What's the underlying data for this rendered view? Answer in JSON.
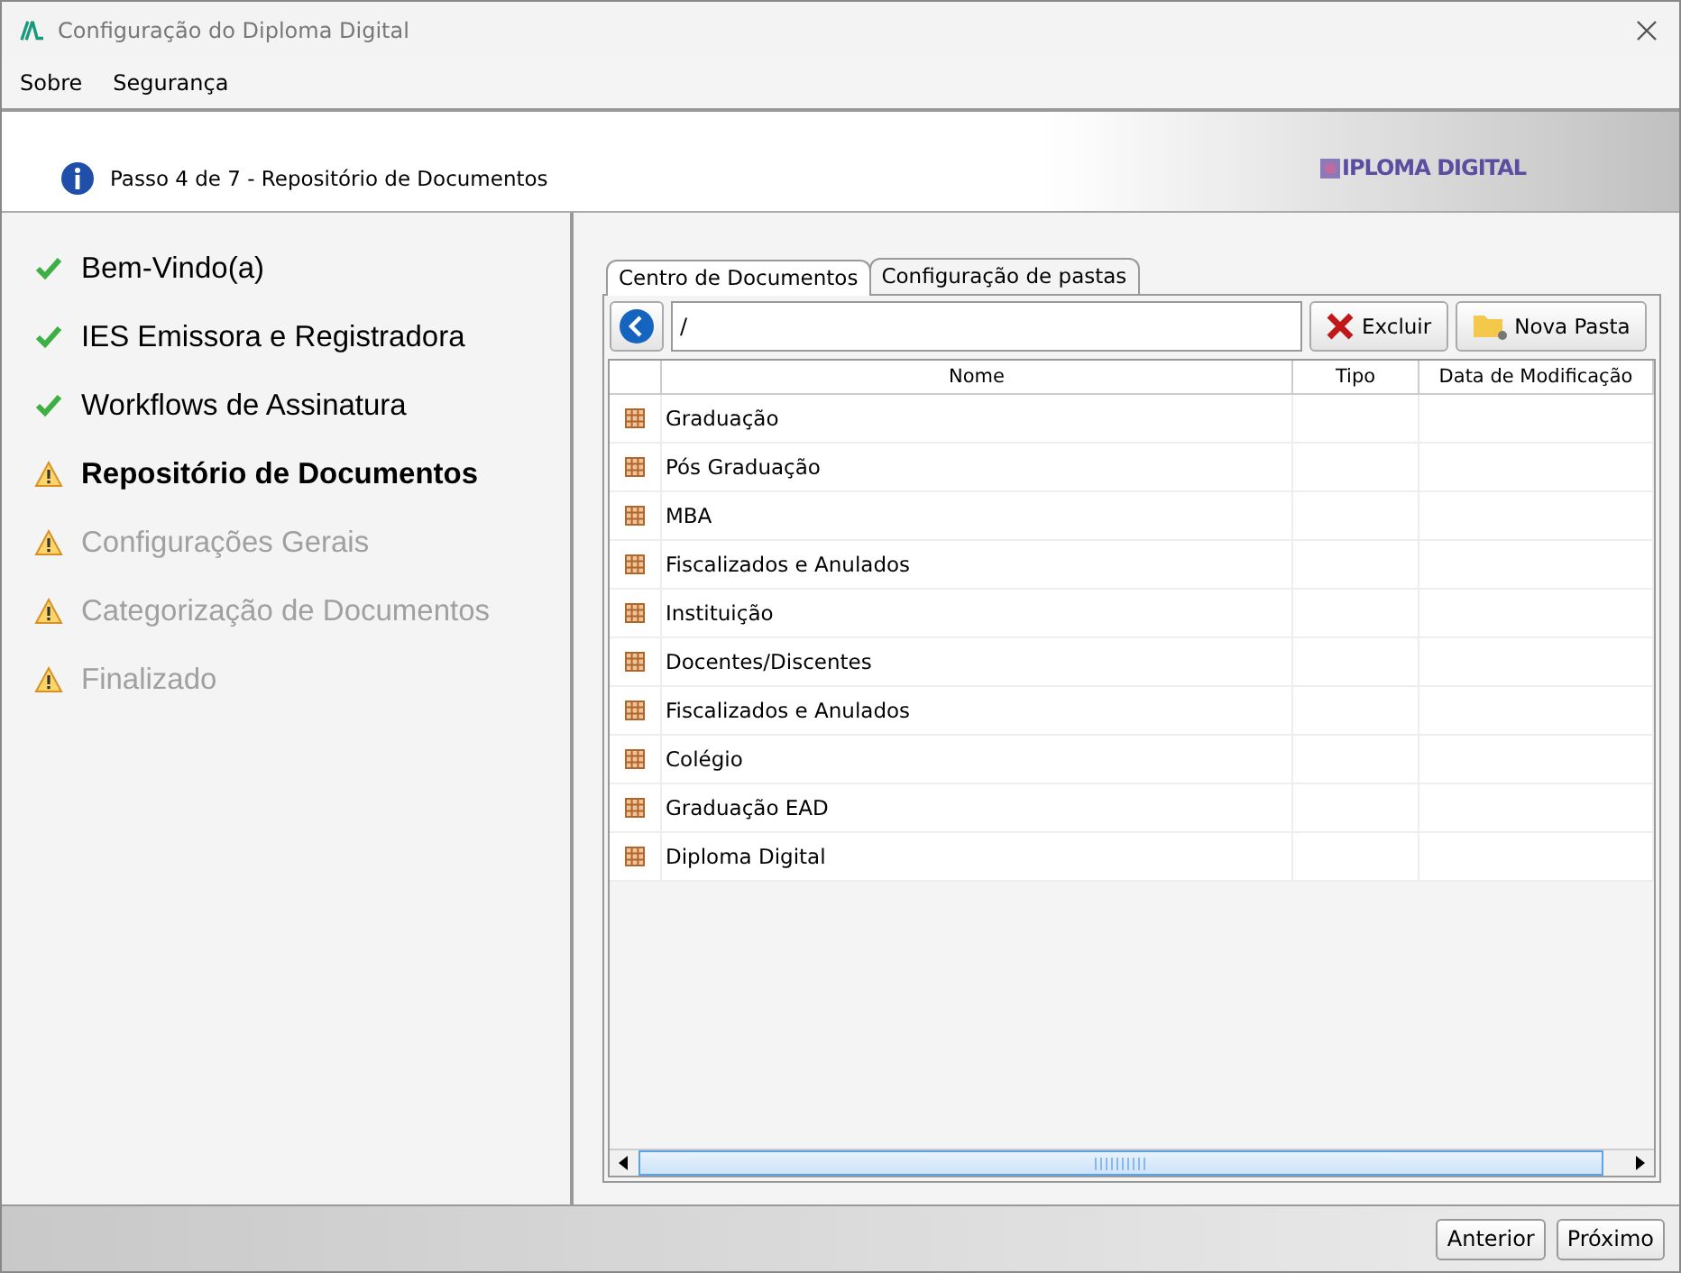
{
  "window": {
    "title": "Configuração do Diploma Digital"
  },
  "menu": [
    "Sobre",
    "Segurança"
  ],
  "header": {
    "step": "Passo 4 de 7 - Repositório de Documentos",
    "logo": "IPLOMA DIGITAL"
  },
  "steps": [
    {
      "label": "Bem-Vindo(a)",
      "kind": "done",
      "current": false,
      "disabled": false
    },
    {
      "label": "IES Emissora e Registradora",
      "kind": "done",
      "current": false,
      "disabled": false
    },
    {
      "label": "Workflows de Assinatura",
      "kind": "done",
      "current": false,
      "disabled": false
    },
    {
      "label": "Repositório de Documentos",
      "kind": "pending",
      "current": true,
      "disabled": false
    },
    {
      "label": "Configurações Gerais",
      "kind": "pending",
      "current": false,
      "disabled": true
    },
    {
      "label": "Categorização de Documentos",
      "kind": "pending",
      "current": false,
      "disabled": true
    },
    {
      "label": "Finalizado",
      "kind": "pending",
      "current": false,
      "disabled": true
    }
  ],
  "tabs": [
    {
      "label": "Centro de Documentos",
      "selected": true
    },
    {
      "label": "Configuração de pastas",
      "selected": false
    }
  ],
  "toolbar": {
    "path": "/",
    "buttons": [
      {
        "label": "Excluir",
        "kind": "delete"
      },
      {
        "label": "Nova Pasta",
        "kind": "folder"
      }
    ]
  },
  "table": {
    "columns": [
      "Nome",
      "Tipo",
      "Data de Modificação"
    ],
    "rows": [
      "Graduação",
      "Pós Graduação",
      "MBA",
      "Fiscalizados e Anulados",
      "Instituição",
      "Docentes/Discentes",
      "Fiscalizados e Anulados",
      "Colégio",
      "Graduação EAD",
      "Diploma Digital"
    ]
  },
  "footer": {
    "buttons": [
      "Anterior",
      "Próximo"
    ]
  }
}
